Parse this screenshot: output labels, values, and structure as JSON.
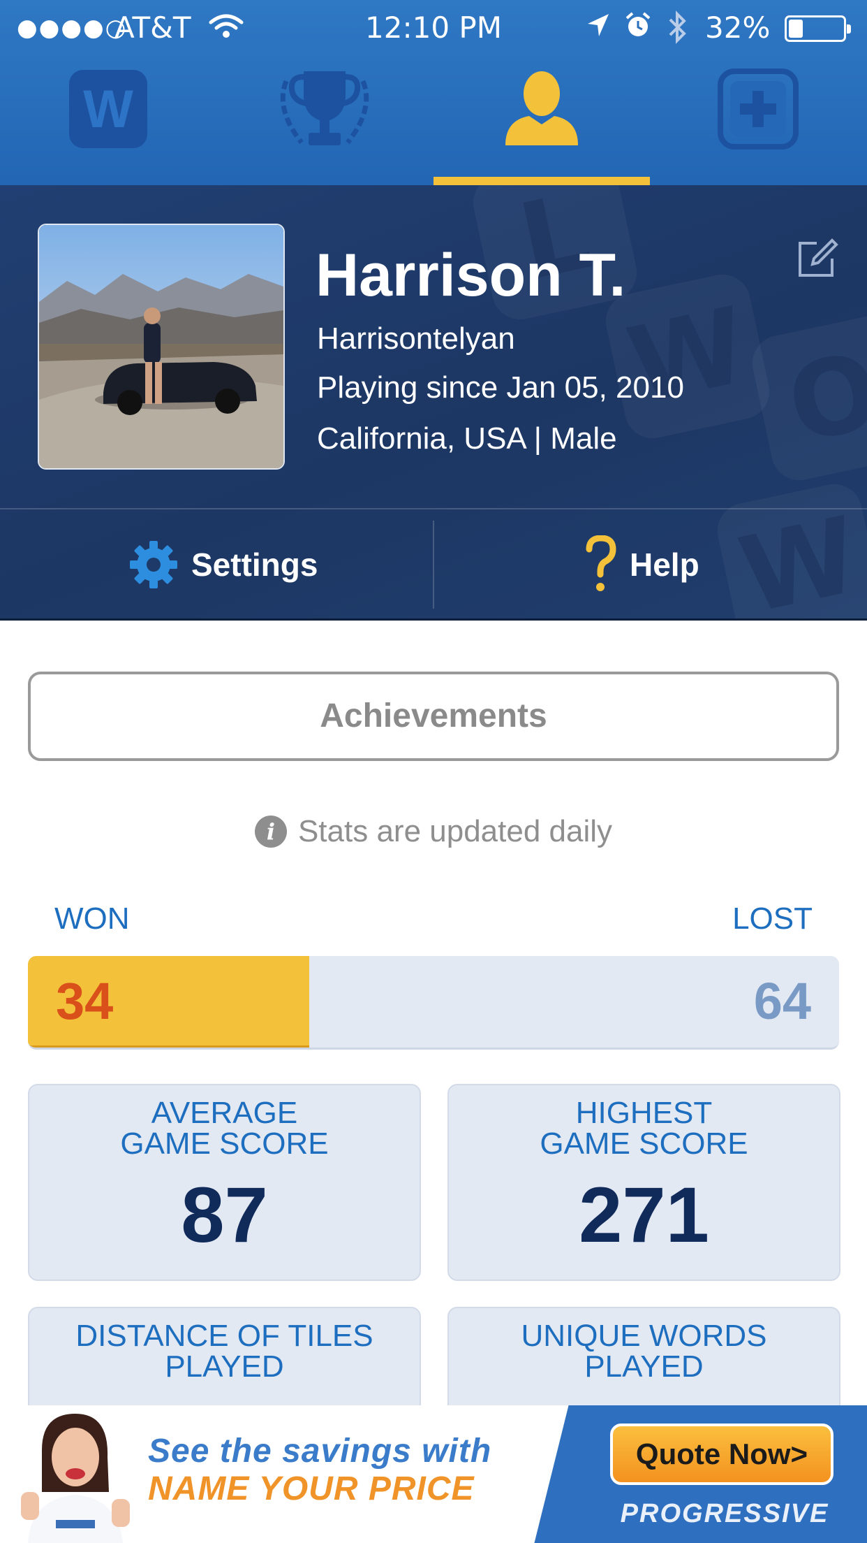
{
  "status_bar": {
    "signal": "●●●●○",
    "carrier": "AT&T",
    "time": "12:10 PM",
    "battery_pct": "32%",
    "battery_level": 0.32
  },
  "nav": {
    "tabs": [
      {
        "icon": "words-logo-icon",
        "active": false
      },
      {
        "icon": "trophy-icon",
        "active": false
      },
      {
        "icon": "profile-icon",
        "active": true
      },
      {
        "icon": "new-game-icon",
        "active": false
      }
    ]
  },
  "profile": {
    "name": "Harrison T.",
    "username": "Harrisontelyan",
    "since": "Playing since Jan 05, 2010",
    "location": "California, USA | Male",
    "settings_label": "Settings",
    "help_label": "Help",
    "bg_letters": [
      "L",
      "W",
      "O",
      "W"
    ]
  },
  "achievements_label": "Achievements",
  "stats_note": "Stats are updated daily",
  "info_glyph": "i",
  "record": {
    "won_label": "WON",
    "lost_label": "LOST",
    "won": "34",
    "lost": "64",
    "won_fraction": 0.347
  },
  "stats": [
    {
      "title": "AVERAGE\nGAME SCORE",
      "value": "87"
    },
    {
      "title": "HIGHEST\nGAME SCORE",
      "value": "271"
    },
    {
      "title": "DISTANCE OF TILES\nPLAYED",
      "value": ""
    },
    {
      "title": "UNIQUE WORDS\nPLAYED",
      "value": ""
    }
  ],
  "ad": {
    "line1": "See the savings with",
    "line2": "NAME YOUR PRICE",
    "cta": "Quote Now>",
    "brand": "PROGRESSIVE"
  },
  "colors": {
    "header_blue": "#2a6fbe",
    "panel_navy": "#1d3764",
    "accent_yellow": "#f4c23a",
    "label_blue": "#1e6ec0",
    "value_navy": "#102a5a"
  }
}
